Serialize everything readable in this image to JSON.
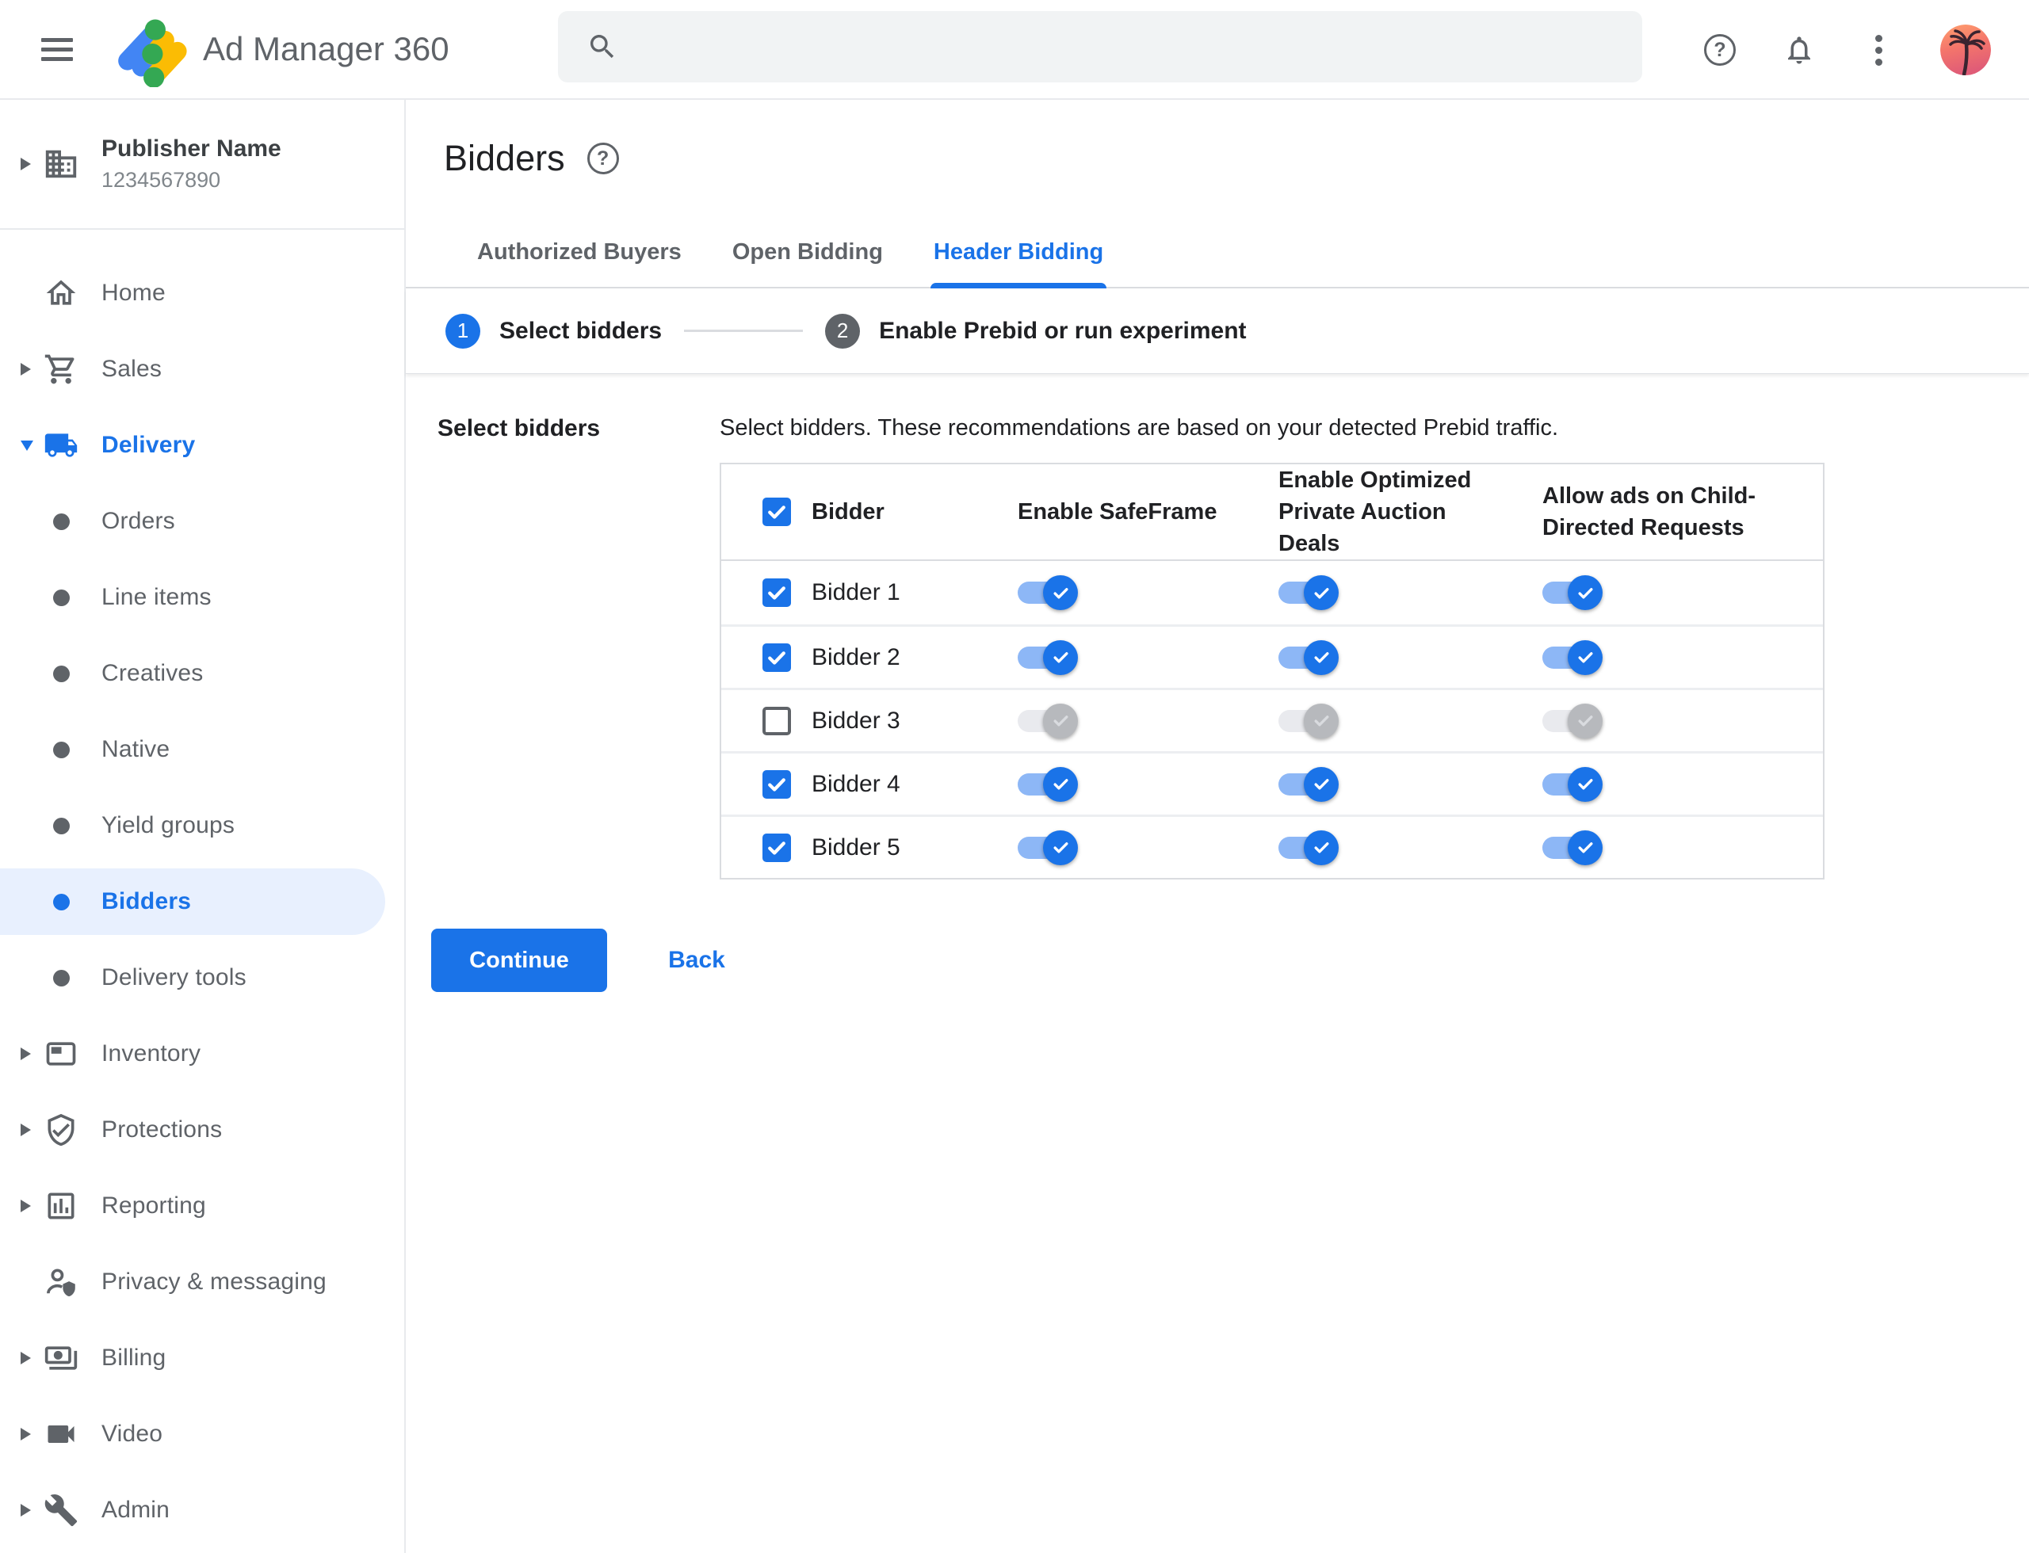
{
  "topbar": {
    "app_title": "Ad Manager 360",
    "search_placeholder": "",
    "search_value": ""
  },
  "glyphs": {
    "question_mark": "?"
  },
  "publisher": {
    "name": "Publisher Name",
    "id": "1234567890"
  },
  "sidebar": {
    "items": [
      {
        "label": "Home"
      },
      {
        "label": "Sales"
      },
      {
        "label": "Delivery"
      },
      {
        "label": "Orders"
      },
      {
        "label": "Line items"
      },
      {
        "label": "Creatives"
      },
      {
        "label": "Native"
      },
      {
        "label": "Yield groups"
      },
      {
        "label": "Bidders",
        "selected": true
      },
      {
        "label": "Delivery tools"
      },
      {
        "label": "Inventory"
      },
      {
        "label": "Protections"
      },
      {
        "label": "Reporting"
      },
      {
        "label": "Privacy & messaging"
      },
      {
        "label": "Billing"
      },
      {
        "label": "Video"
      },
      {
        "label": "Admin"
      }
    ]
  },
  "page": {
    "title": "Bidders"
  },
  "tabs": [
    {
      "label": "Authorized Buyers",
      "active": false
    },
    {
      "label": "Open Bidding",
      "active": false
    },
    {
      "label": "Header Bidding",
      "active": true
    }
  ],
  "stepper": [
    {
      "number": "1",
      "label": "Select bidders",
      "active": true
    },
    {
      "number": "2",
      "label": "Enable Prebid or run experiment",
      "active": false
    }
  ],
  "form": {
    "section_label": "Select bidders",
    "description": "Select bidders. These recommendations are based on your detected Prebid traffic.",
    "table": {
      "header_checkbox_checked": true,
      "headers": [
        "Bidder",
        "Enable SafeFrame",
        "Enable Optimized Private Auction Deals",
        "Allow ads on Child-Directed Requests"
      ],
      "rows": [
        {
          "name": "Bidder 1",
          "checked": true,
          "safeframe": true,
          "optimized_deals": true,
          "child_directed": true
        },
        {
          "name": "Bidder 2",
          "checked": true,
          "safeframe": true,
          "optimized_deals": true,
          "child_directed": true
        },
        {
          "name": "Bidder 3",
          "checked": false,
          "safeframe": false,
          "optimized_deals": false,
          "child_directed": false
        },
        {
          "name": "Bidder 4",
          "checked": true,
          "safeframe": true,
          "optimized_deals": true,
          "child_directed": true
        },
        {
          "name": "Bidder 5",
          "checked": true,
          "safeframe": true,
          "optimized_deals": true,
          "child_directed": true
        }
      ]
    },
    "continue_label": "Continue",
    "back_label": "Back"
  },
  "colors": {
    "accent_blue": "#1a73e8",
    "selected_item_bg": "#e8f0fe",
    "toggle_on_track": "#8db7f6",
    "toggle_off_track": "#e9eaee",
    "toggle_off_thumb": "#b7b9bd",
    "text_dark": "#202124",
    "text_gray": "#5f6368",
    "border_gray": "#dadce0",
    "search_bg": "#f1f3f4"
  }
}
